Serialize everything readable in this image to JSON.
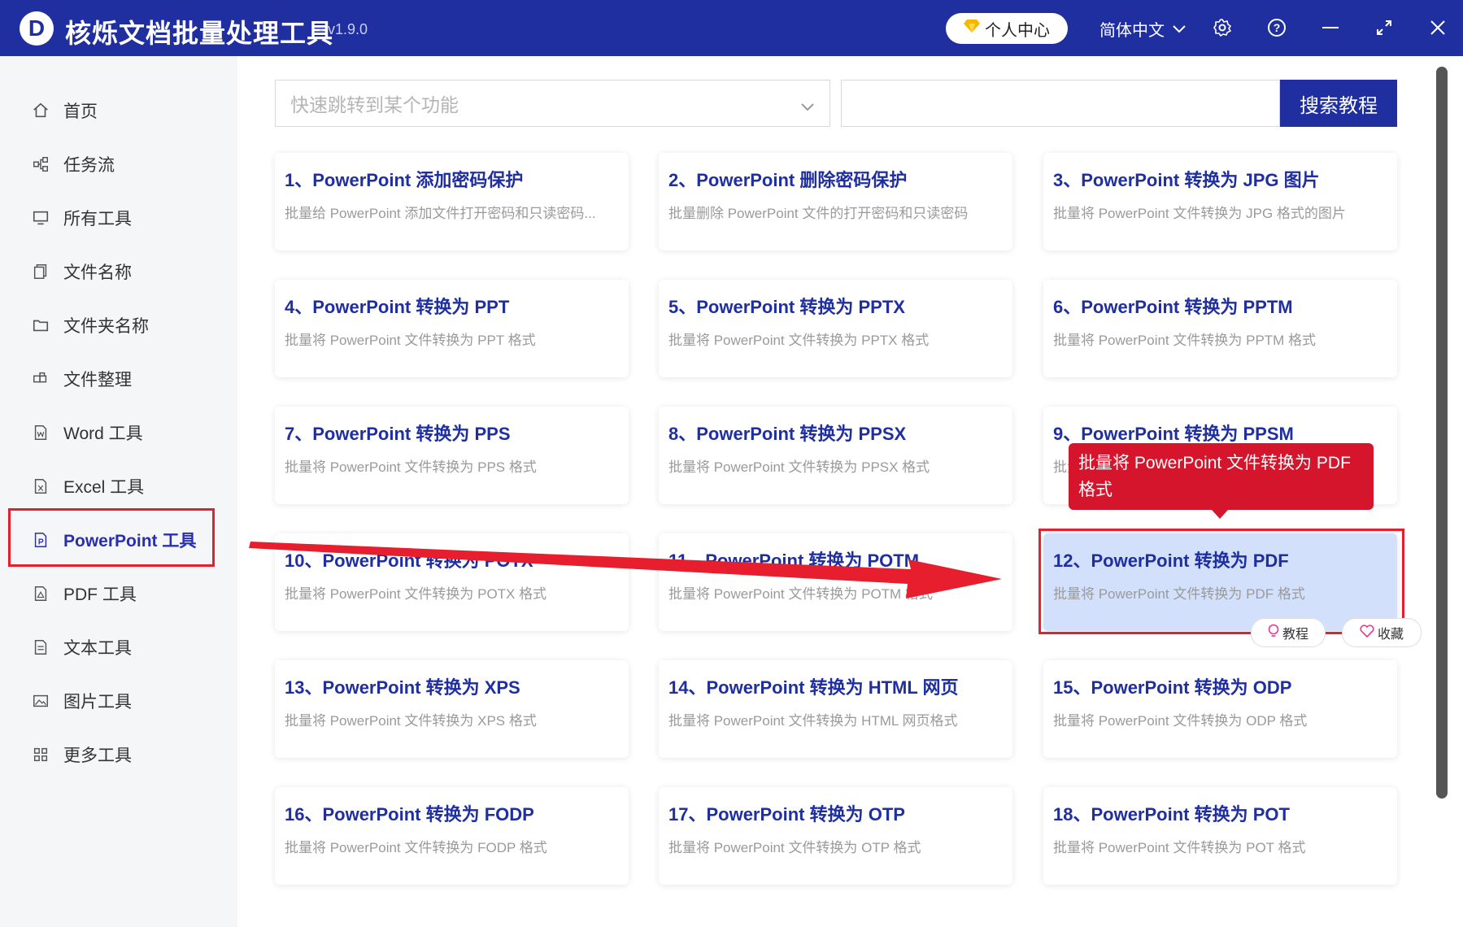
{
  "app": {
    "logo_letter": "D",
    "title": "核烁文档批量处理工具",
    "version": "- v1.9.0",
    "user_center": "个人中心",
    "language": "简体中文"
  },
  "sidebar": {
    "items": [
      {
        "label": "首页",
        "icon": "home-icon"
      },
      {
        "label": "任务流",
        "icon": "workflow-icon"
      },
      {
        "label": "所有工具",
        "icon": "monitor-icon"
      },
      {
        "label": "文件名称",
        "icon": "file-copy-icon"
      },
      {
        "label": "文件夹名称",
        "icon": "folder-icon"
      },
      {
        "label": "文件整理",
        "icon": "organize-icon"
      },
      {
        "label": "Word 工具",
        "icon": "word-file-icon"
      },
      {
        "label": "Excel 工具",
        "icon": "excel-file-icon"
      },
      {
        "label": "PowerPoint 工具",
        "icon": "powerpoint-file-icon",
        "active": true
      },
      {
        "label": "PDF 工具",
        "icon": "pdf-file-icon"
      },
      {
        "label": "文本工具",
        "icon": "text-file-icon"
      },
      {
        "label": "图片工具",
        "icon": "image-icon"
      },
      {
        "label": "更多工具",
        "icon": "grid-icon"
      }
    ]
  },
  "search": {
    "jump_placeholder": "快速跳转到某个功能",
    "tutorial_input_value": "",
    "search_button": "搜索教程"
  },
  "tools": [
    {
      "title": "1、PowerPoint 添加密码保护",
      "desc": "批量给 PowerPoint 添加文件打开密码和只读密码..."
    },
    {
      "title": "2、PowerPoint 删除密码保护",
      "desc": "批量删除 PowerPoint 文件的打开密码和只读密码"
    },
    {
      "title": "3、PowerPoint 转换为 JPG 图片",
      "desc": "批量将 PowerPoint 文件转换为 JPG 格式的图片"
    },
    {
      "title": "4、PowerPoint 转换为 PPT",
      "desc": "批量将 PowerPoint 文件转换为 PPT 格式"
    },
    {
      "title": "5、PowerPoint 转换为 PPTX",
      "desc": "批量将 PowerPoint 文件转换为 PPTX 格式"
    },
    {
      "title": "6、PowerPoint 转换为 PPTM",
      "desc": "批量将 PowerPoint 文件转换为 PPTM 格式"
    },
    {
      "title": "7、PowerPoint 转换为 PPS",
      "desc": "批量将 PowerPoint 文件转换为 PPS 格式"
    },
    {
      "title": "8、PowerPoint 转换为 PPSX",
      "desc": "批量将 PowerPoint 文件转换为 PPSX 格式"
    },
    {
      "title": "9、PowerPoint 转换为 PPSM",
      "desc": "批量将 PowerPoint 文件转换为 PPSM 格式"
    },
    {
      "title": "10、PowerPoint 转换为 POTX",
      "desc": "批量将 PowerPoint 文件转换为 POTX 格式"
    },
    {
      "title": "11、PowerPoint 转换为 POTM",
      "desc": "批量将 PowerPoint 文件转换为 POTM 格式"
    },
    {
      "title": "12、PowerPoint 转换为 PDF",
      "desc": "批量将 PowerPoint 文件转换为 PDF 格式",
      "highlighted": true
    },
    {
      "title": "13、PowerPoint 转换为 XPS",
      "desc": "批量将 PowerPoint 文件转换为 XPS 格式"
    },
    {
      "title": "14、PowerPoint 转换为 HTML 网页",
      "desc": "批量将 PowerPoint 文件转换为 HTML 网页格式"
    },
    {
      "title": "15、PowerPoint 转换为 ODP",
      "desc": "批量将 PowerPoint 文件转换为 ODP 格式"
    },
    {
      "title": "16、PowerPoint 转换为 FODP",
      "desc": "批量将 PowerPoint 文件转换为 FODP 格式"
    },
    {
      "title": "17、PowerPoint 转换为 OTP",
      "desc": "批量将 PowerPoint 文件转换为 OTP 格式"
    },
    {
      "title": "18、PowerPoint 转换为 POT",
      "desc": "批量将 PowerPoint 文件转换为 POT 格式"
    }
  ],
  "hover_card": {
    "tooltip": "批量将 PowerPoint 文件转换为 PDF 格式",
    "tutorial_button": "教程",
    "favorite_button": "收藏"
  },
  "colors": {
    "brand": "#1f2fa0",
    "annotation_red": "#e61e2e",
    "highlight_bg": "#d3e0fb"
  }
}
